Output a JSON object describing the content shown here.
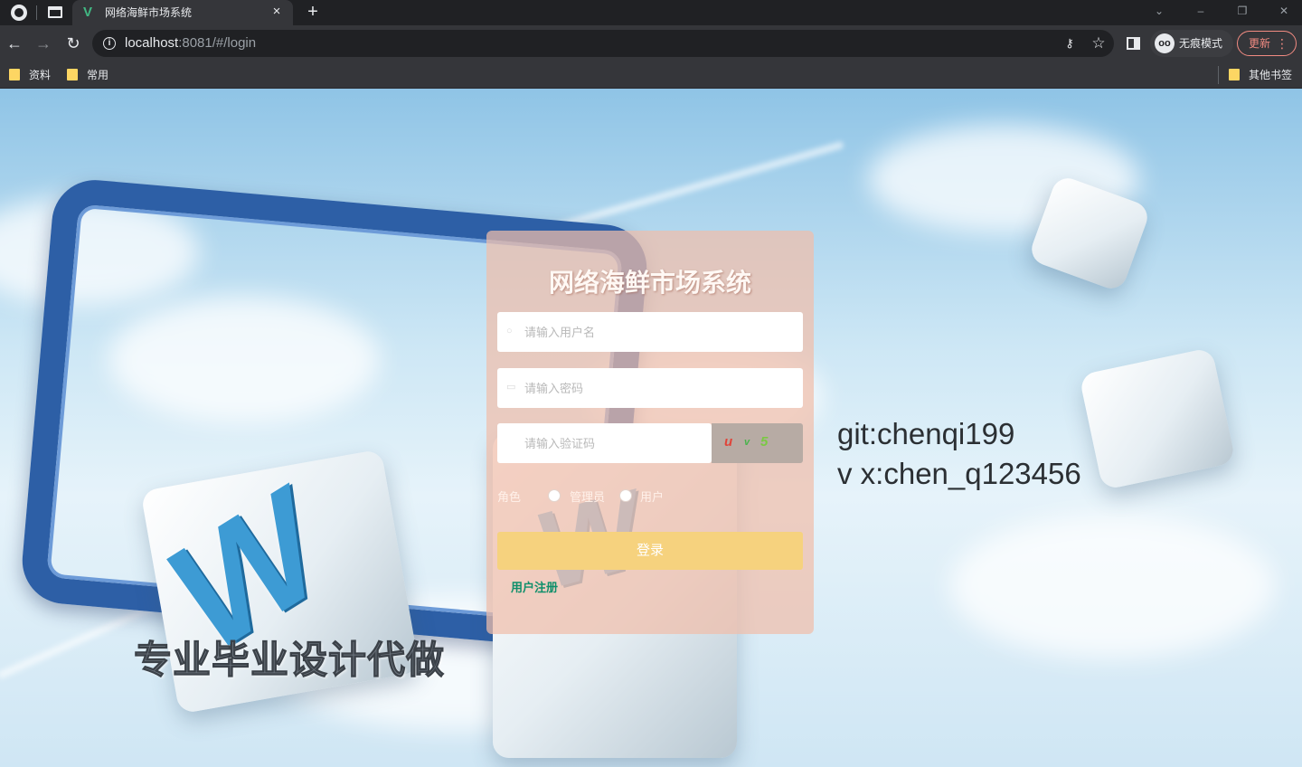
{
  "browser": {
    "tab_title": "网络海鲜市场系统",
    "tab_close": "×",
    "new_tab": "+",
    "url_host": "localhost",
    "url_rest": ":8081/#/login",
    "incognito_label": "无痕模式",
    "update_label": "更新",
    "bookmarks": [
      "资料",
      "常用"
    ],
    "other_bookmarks": "其他书签"
  },
  "login": {
    "title": "网络海鲜市场系统",
    "username_placeholder": "请输入用户名",
    "password_placeholder": "请输入密码",
    "captcha_placeholder": "请输入验证码",
    "captcha_chars": [
      "u",
      "v",
      "5"
    ],
    "role_label": "角色",
    "roles": [
      "管理员",
      "用户"
    ],
    "login_button": "登录",
    "register_link": "用户注册"
  },
  "watermarks": {
    "service": "专业毕业设计代做",
    "git": "git:chenqi199",
    "wechat": "v x:chen_q123456"
  },
  "colors": {
    "card": "#f0beaa",
    "login_button": "#f6d27e",
    "register_link": "#0f8f6a",
    "captcha_colors": [
      "#e0443a",
      "#48b34b",
      "#7ac943"
    ]
  }
}
